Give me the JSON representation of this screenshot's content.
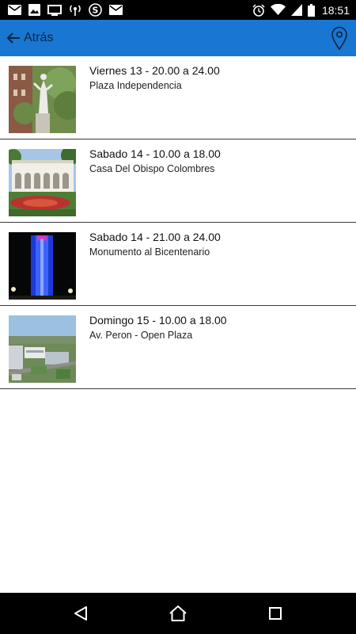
{
  "status_bar": {
    "time": "18:51",
    "left_icons": [
      "mail-icon",
      "image-icon",
      "cast-icon",
      "hotspot-icon",
      "app-s-icon",
      "mail-icon"
    ],
    "right_icons": [
      "alarm-icon",
      "wifi-icon",
      "signal-icon",
      "battery-icon"
    ]
  },
  "header": {
    "back_label": "Atrás",
    "background_color": "#1976d2",
    "right_icon": "map-pin-icon"
  },
  "events": [
    {
      "title": "Viernes 13 - 20.00 a 24.00",
      "place": "Plaza Independencia",
      "thumb": "statue-photo"
    },
    {
      "title": "Sabado 14 - 10.00 a 18.00",
      "place": "Casa Del Obispo Colombres",
      "thumb": "colonial-house-photo"
    },
    {
      "title": "Sabado 14 - 21.00 a 24.00",
      "place": "Monumento al Bicentenario",
      "thumb": "monument-night-photo"
    },
    {
      "title": "Domingo 15 - 10.00 a 18.00",
      "place": "Av. Peron - Open Plaza",
      "thumb": "aerial-city-photo"
    }
  ],
  "nav_bar": {
    "buttons": [
      "back-triangle-icon",
      "home-circle-icon",
      "recents-square-icon"
    ]
  }
}
